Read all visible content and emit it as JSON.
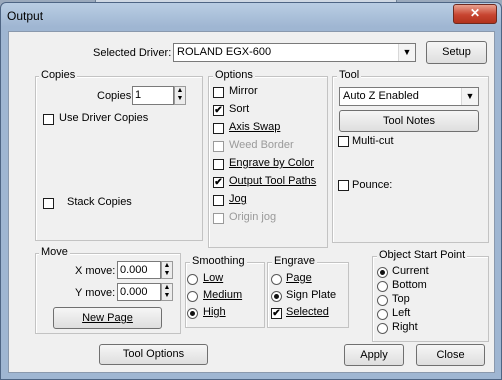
{
  "window": {
    "title": "Output",
    "close_glyph": "✕"
  },
  "driver": {
    "label": "Selected Driver:",
    "value": "ROLAND EGX-600",
    "setup_label": "Setup"
  },
  "copies": {
    "group_title": "Copies",
    "copies_label": "Copies:",
    "copies_value": "1",
    "use_driver_copies": {
      "label": "Use Driver Copies",
      "checked": false
    },
    "stack_copies": {
      "label": "Stack Copies",
      "checked": false
    }
  },
  "options": {
    "group_title": "Options",
    "items": [
      {
        "label": "Mirror",
        "checked": false,
        "enabled": true
      },
      {
        "label": "Sort",
        "checked": true,
        "enabled": true
      },
      {
        "label": "Axis Swap",
        "checked": false,
        "enabled": true
      },
      {
        "label": "Weed Border",
        "checked": false,
        "enabled": false
      },
      {
        "label": "Engrave by Color",
        "checked": false,
        "enabled": true
      },
      {
        "label": "Output Tool Paths",
        "checked": true,
        "enabled": true
      },
      {
        "label": "Jog",
        "checked": false,
        "enabled": true
      },
      {
        "label": "Origin jog",
        "checked": false,
        "enabled": false
      }
    ]
  },
  "tool": {
    "group_title": "Tool",
    "mode_value": "Auto Z Enabled",
    "notes_label": "Tool Notes",
    "multicut": {
      "label": "Multi-cut",
      "checked": false
    },
    "pounce": {
      "label": "Pounce:",
      "checked": false
    }
  },
  "move": {
    "group_title": "Move",
    "x_label": "X move:",
    "x_value": "0.000",
    "y_label": "Y move:",
    "y_value": "0.000",
    "new_page_label": "New Page"
  },
  "smoothing": {
    "group_title": "Smoothing",
    "options": [
      {
        "label": "Low",
        "selected": false
      },
      {
        "label": "Medium",
        "selected": false
      },
      {
        "label": "High",
        "selected": true
      }
    ]
  },
  "engrave": {
    "group_title": "Engrave",
    "options": [
      {
        "label": "Page",
        "selected": false
      },
      {
        "label": "Sign Plate",
        "selected": true
      }
    ],
    "selected_cb": {
      "label": "Selected",
      "checked": true
    }
  },
  "object_start": {
    "group_title": "Object Start Point",
    "options": [
      {
        "label": "Current",
        "selected": true
      },
      {
        "label": "Bottom",
        "selected": false
      },
      {
        "label": "Top",
        "selected": false
      },
      {
        "label": "Left",
        "selected": false
      },
      {
        "label": "Right",
        "selected": false
      }
    ]
  },
  "footer": {
    "tool_options_label": "Tool Options",
    "apply_label": "Apply",
    "close_label": "Close"
  }
}
